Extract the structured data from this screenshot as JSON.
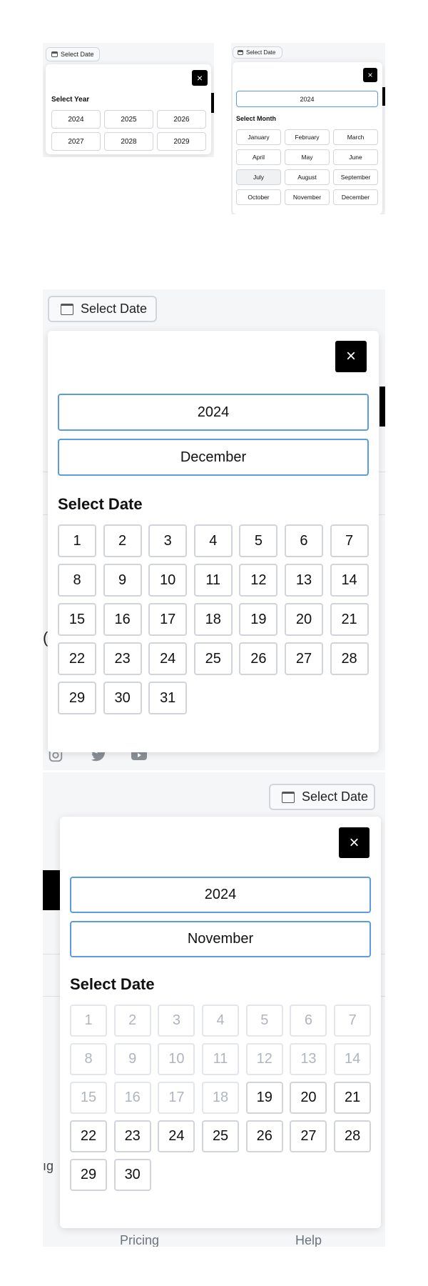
{
  "common": {
    "select_date_label": "Select Date",
    "close_glyph": "×"
  },
  "year_picker": {
    "title": "Select Year",
    "years": [
      "2024",
      "2025",
      "2026",
      "2027",
      "2028",
      "2029"
    ]
  },
  "month_picker": {
    "year_value": "2024",
    "title": "Select Month",
    "months": [
      "January",
      "February",
      "March",
      "April",
      "May",
      "June",
      "July",
      "August",
      "September",
      "October",
      "November",
      "December"
    ],
    "selected_month": "July"
  },
  "december_picker": {
    "year_value": "2024",
    "month_value": "December",
    "title": "Select Date",
    "days": [
      "1",
      "2",
      "3",
      "4",
      "5",
      "6",
      "7",
      "8",
      "9",
      "10",
      "11",
      "12",
      "13",
      "14",
      "15",
      "16",
      "17",
      "18",
      "19",
      "20",
      "21",
      "22",
      "23",
      "24",
      "25",
      "26",
      "27",
      "28",
      "29",
      "30",
      "31"
    ]
  },
  "november_picker": {
    "year_value": "2024",
    "month_value": "November",
    "title": "Select Date",
    "days": [
      "1",
      "2",
      "3",
      "4",
      "5",
      "6",
      "7",
      "8",
      "9",
      "10",
      "11",
      "12",
      "13",
      "14",
      "15",
      "16",
      "17",
      "18",
      "19",
      "20",
      "21",
      "22",
      "23",
      "24",
      "25",
      "26",
      "27",
      "28",
      "29",
      "30"
    ],
    "first_enabled_day": 19
  },
  "background": {
    "partial_link_left": "ıg",
    "partial_link_pricing": "Pricing",
    "partial_link_help": "Help"
  },
  "colors": {
    "field_border": "#5b9be6",
    "close_bg": "#000000",
    "disabled_text": "#b0b5bd"
  }
}
